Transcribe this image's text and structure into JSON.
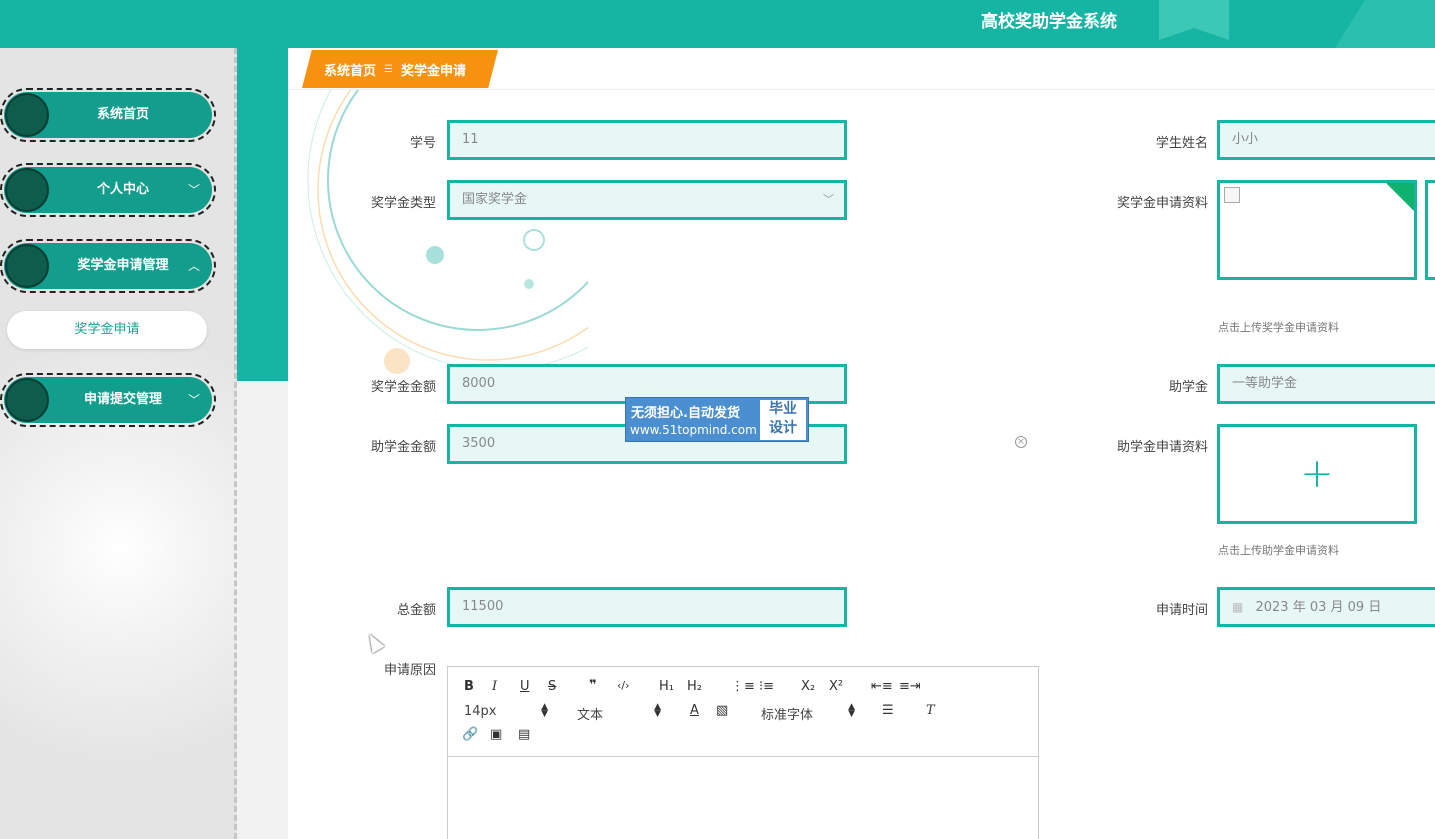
{
  "header": {
    "title": "高校奖助学金系统"
  },
  "sidebar": {
    "items": [
      {
        "label": "系统首页",
        "chevron": ""
      },
      {
        "label": "个人中心",
        "chevron": "﹀"
      },
      {
        "label": "奖学金申请管理",
        "chevron": "︿"
      },
      {
        "label": "申请提交管理",
        "chevron": "﹀"
      }
    ],
    "subitem": "奖学金申请"
  },
  "breadcrumb": {
    "home": "系统首页",
    "separator": "☰",
    "current": "奖学金申请"
  },
  "form": {
    "student_no": {
      "label": "学号",
      "value": "11"
    },
    "student_name": {
      "label": "学生姓名",
      "value": "小小"
    },
    "scholarship_type": {
      "label": "奖学金类型",
      "value": "国家奖学金",
      "caret": "﹀"
    },
    "scholarship_material": {
      "label": "奖学金申请资料",
      "hint": "点击上传奖学金申请资料"
    },
    "scholarship_amount": {
      "label": "奖学金金额",
      "value": "8000"
    },
    "grant": {
      "label": "助学金",
      "value": "一等助学金"
    },
    "grant_amount": {
      "label": "助学金金额",
      "value": "3500"
    },
    "grant_material": {
      "label": "助学金申请资料",
      "hint": "点击上传助学金申请资料",
      "plus": "+"
    },
    "total": {
      "label": "总金额",
      "value": "11500"
    },
    "apply_time": {
      "label": "申请时间",
      "value": "2023 年 03 月 09 日"
    },
    "reason": {
      "label": "申请原因"
    }
  },
  "editor": {
    "buttons": {
      "bold": "B",
      "italic": "I",
      "underline": "U",
      "strike": "S",
      "quote": "❞",
      "code": "‹/›",
      "h1": "H₁",
      "h2": "H₂",
      "ol": "⋮≡",
      "ul": "⁝≡",
      "sub": "X₂",
      "sup": "X²",
      "outdent": "⇤≡",
      "indent": "≡⇥"
    },
    "size": "14px",
    "format": "文本",
    "font": "标准字体"
  },
  "watermark": {
    "line1": "无须担心.自动发货",
    "line2": "www.51topmind.com",
    "side1": "毕业",
    "side2": "设计"
  },
  "colors": {
    "primary": "#16b4a2",
    "accent": "#f7920f",
    "sidebar_dark": "#139d8c"
  }
}
